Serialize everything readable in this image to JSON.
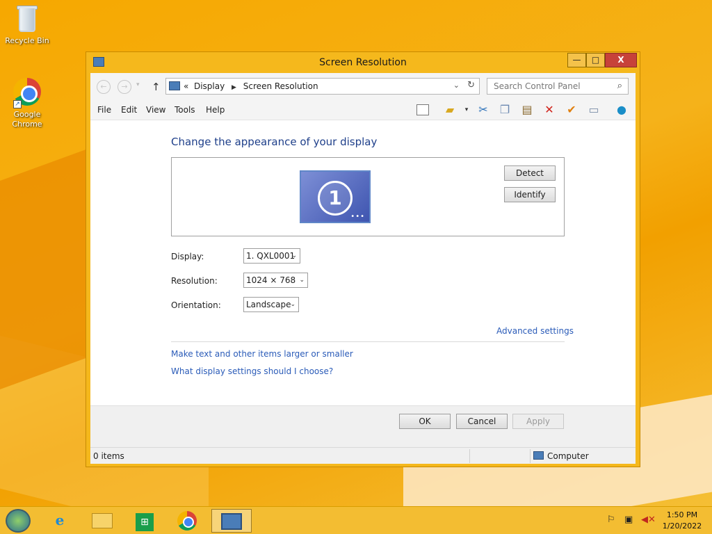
{
  "desktop": {
    "icons": [
      {
        "label": "Recycle Bin"
      },
      {
        "label": "Google Chrome"
      }
    ]
  },
  "window": {
    "title": "Screen Resolution",
    "controls": {
      "minimize": "—",
      "maximize": "□",
      "close": "X"
    }
  },
  "navigation": {
    "back_glyph": "←",
    "forward_glyph": "→",
    "up_glyph": "↑",
    "breadcrumb_prefix": "«",
    "breadcrumb": [
      "Display",
      "Screen Resolution"
    ],
    "breadcrumb_sep": "▶",
    "search_placeholder": "Search Control Panel"
  },
  "menu": [
    "File",
    "Edit",
    "View",
    "Tools",
    "Help"
  ],
  "toolbar_icons": [
    "layout-pane-icon",
    "folder-views-icon",
    "cut-icon",
    "copy-icon",
    "paste-icon",
    "delete-icon",
    "checkmark-icon",
    "rename-icon",
    "shell-icon"
  ],
  "content": {
    "heading": "Change the appearance of your display",
    "monitor_number": "1",
    "detect_label": "Detect",
    "identify_label": "Identify",
    "display_label": "Display:",
    "display_value": "1. QXL0001",
    "resolution_label": "Resolution:",
    "resolution_value": "1024 × 768",
    "orientation_label": "Orientation:",
    "orientation_value": "Landscape",
    "advanced_link": "Advanced settings",
    "link_text_size": "Make text and other items larger or smaller",
    "link_help": "What display settings should I choose?"
  },
  "footer": {
    "ok": "OK",
    "cancel": "Cancel",
    "apply": "Apply"
  },
  "statusbar": {
    "items": "0 items",
    "location": "Computer"
  },
  "taskbar": {
    "time": "1:50 PM",
    "date": "1/20/2022"
  },
  "colors": {
    "wallpaper": "#f5b21a",
    "heading": "#1e3f8a",
    "link": "#2a5bb8",
    "close_button": "#c7423a"
  }
}
